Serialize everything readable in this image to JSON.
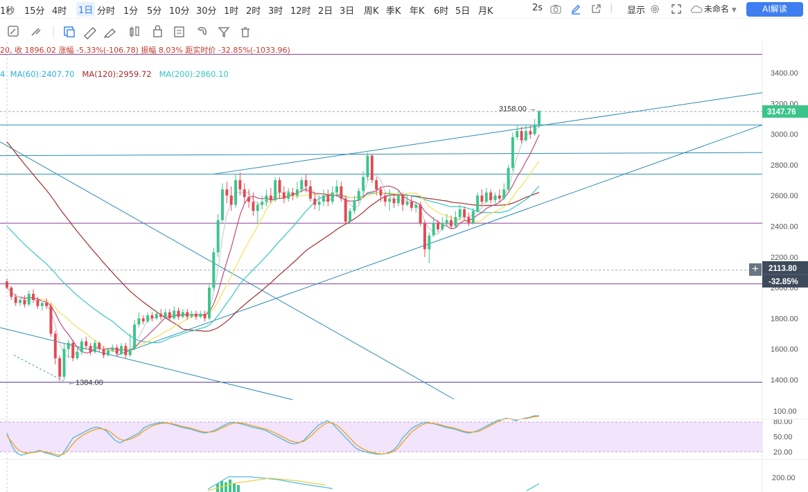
{
  "periods": [
    "1秒",
    "15分",
    "4时",
    "1日",
    "分时",
    "1分",
    "5分",
    "10分",
    "30分",
    "1时",
    "2时",
    "3时",
    "12时",
    "2日",
    "3日",
    "周K",
    "季K",
    "年K",
    "6时",
    "5日",
    "月K"
  ],
  "active_period": "1日",
  "top_right": {
    "refresh": "2s",
    "display": "显示",
    "layout_name": "未命名",
    "ai_button": "AI解读"
  },
  "info_line": {
    "prefix": "20,",
    "close": "收 1896.02",
    "change": "涨幅 -5.33%(-106.78)",
    "amplitude": "振幅 8.03%",
    "distance": "距实时价 -32.85%(-1033.96)"
  },
  "ma_legend": [
    {
      "label": "MA(60):2407.70",
      "color": "#2ab0d6"
    },
    {
      "label": "MA(120):2959.72",
      "color": "#a12c2c"
    },
    {
      "label": "MA(200):2860.10",
      "color": "#35c6c2"
    }
  ],
  "colors": {
    "up": "#3cc58b",
    "down": "#e04a54",
    "price_tag": "#3cc58b",
    "cursor_tag": "#3d4a5c"
  },
  "chart_data": {
    "type": "candlestick",
    "y_ticks": [
      3400,
      3200,
      3000,
      2800,
      2600,
      2400,
      2200,
      2000,
      1800,
      1600,
      1400
    ],
    "y_tick_labels": [
      "3400.00",
      "3200.00",
      "3000.00",
      "2800.00",
      "2600.00",
      "2400.00",
      "2200.00",
      "2000.00",
      "1800.00",
      "1600.00",
      "1400.00"
    ],
    "last_price": 3147.76,
    "last_price_label": "3147.76",
    "cursor_price_label": "2113.80",
    "cursor_pct_label": "-32.85%",
    "high_label": "3158.00",
    "low_label": "1384.00",
    "candles": [
      [
        2040,
        2000,
        2060,
        1990
      ],
      [
        2000,
        1940,
        2010,
        1920
      ],
      [
        1940,
        1900,
        1960,
        1880
      ],
      [
        1900,
        1920,
        1940,
        1880
      ],
      [
        1920,
        1890,
        1950,
        1870
      ],
      [
        1890,
        1960,
        1980,
        1880
      ],
      [
        1960,
        1920,
        1990,
        1900
      ],
      [
        1920,
        1880,
        1940,
        1860
      ],
      [
        1880,
        1900,
        1910,
        1850
      ],
      [
        1900,
        1880,
        1930,
        1860
      ],
      [
        1880,
        1700,
        1900,
        1680
      ],
      [
        1700,
        1540,
        1720,
        1500
      ],
      [
        1540,
        1420,
        1560,
        1390
      ],
      [
        1420,
        1600,
        1640,
        1400
      ],
      [
        1600,
        1640,
        1660,
        1540
      ],
      [
        1640,
        1540,
        1660,
        1520
      ],
      [
        1540,
        1580,
        1620,
        1530
      ],
      [
        1580,
        1650,
        1670,
        1560
      ],
      [
        1650,
        1620,
        1680,
        1600
      ],
      [
        1620,
        1580,
        1640,
        1560
      ],
      [
        1580,
        1640,
        1660,
        1570
      ],
      [
        1640,
        1600,
        1650,
        1580
      ],
      [
        1600,
        1560,
        1620,
        1540
      ],
      [
        1560,
        1590,
        1610,
        1550
      ],
      [
        1590,
        1610,
        1630,
        1580
      ],
      [
        1610,
        1570,
        1630,
        1550
      ],
      [
        1570,
        1620,
        1640,
        1560
      ],
      [
        1620,
        1560,
        1640,
        1540
      ],
      [
        1560,
        1600,
        1700,
        1550
      ],
      [
        1600,
        1760,
        1790,
        1590
      ],
      [
        1760,
        1800,
        1840,
        1740
      ],
      [
        1800,
        1780,
        1820,
        1760
      ],
      [
        1780,
        1820,
        1840,
        1770
      ],
      [
        1820,
        1800,
        1840,
        1780
      ],
      [
        1800,
        1830,
        1850,
        1790
      ],
      [
        1830,
        1810,
        1860,
        1790
      ],
      [
        1810,
        1840,
        1860,
        1800
      ],
      [
        1840,
        1800,
        1860,
        1780
      ],
      [
        1800,
        1850,
        1880,
        1790
      ],
      [
        1850,
        1810,
        1870,
        1790
      ],
      [
        1810,
        1840,
        1860,
        1800
      ],
      [
        1840,
        1810,
        1860,
        1790
      ],
      [
        1810,
        1830,
        1850,
        1800
      ],
      [
        1830,
        1810,
        1850,
        1790
      ],
      [
        1810,
        1830,
        1850,
        1800
      ],
      [
        1830,
        1800,
        1850,
        1780
      ],
      [
        1800,
        2000,
        2020,
        1790
      ],
      [
        2000,
        2230,
        2260,
        1980
      ],
      [
        2230,
        2440,
        2480,
        2200
      ],
      [
        2440,
        2640,
        2680,
        2420
      ],
      [
        2640,
        2600,
        2690,
        2550
      ],
      [
        2600,
        2540,
        2660,
        2500
      ],
      [
        2540,
        2700,
        2740,
        2520
      ],
      [
        2700,
        2640,
        2750,
        2600
      ],
      [
        2640,
        2590,
        2680,
        2550
      ],
      [
        2590,
        2560,
        2640,
        2520
      ],
      [
        2560,
        2500,
        2620,
        2470
      ],
      [
        2500,
        2540,
        2560,
        2420
      ],
      [
        2540,
        2560,
        2600,
        2510
      ],
      [
        2560,
        2600,
        2640,
        2530
      ],
      [
        2600,
        2570,
        2650,
        2550
      ],
      [
        2570,
        2700,
        2720,
        2560
      ],
      [
        2700,
        2620,
        2720,
        2580
      ],
      [
        2620,
        2580,
        2660,
        2550
      ],
      [
        2580,
        2620,
        2650,
        2560
      ],
      [
        2620,
        2600,
        2650,
        2570
      ],
      [
        2600,
        2640,
        2690,
        2580
      ],
      [
        2640,
        2700,
        2720,
        2620
      ],
      [
        2700,
        2660,
        2740,
        2620
      ],
      [
        2660,
        2580,
        2700,
        2560
      ],
      [
        2580,
        2540,
        2620,
        2510
      ],
      [
        2540,
        2560,
        2600,
        2500
      ],
      [
        2560,
        2600,
        2640,
        2530
      ],
      [
        2600,
        2560,
        2640,
        2530
      ],
      [
        2560,
        2620,
        2660,
        2540
      ],
      [
        2620,
        2660,
        2700,
        2600
      ],
      [
        2660,
        2580,
        2690,
        2560
      ],
      [
        2580,
        2430,
        2600,
        2410
      ],
      [
        2430,
        2500,
        2520,
        2420
      ],
      [
        2500,
        2570,
        2600,
        2480
      ],
      [
        2570,
        2630,
        2650,
        2550
      ],
      [
        2630,
        2720,
        2760,
        2600
      ],
      [
        2720,
        2860,
        2880,
        2700
      ],
      [
        2860,
        2700,
        2870,
        2680
      ],
      [
        2700,
        2640,
        2720,
        2600
      ],
      [
        2640,
        2600,
        2660,
        2560
      ],
      [
        2600,
        2560,
        2620,
        2530
      ],
      [
        2560,
        2580,
        2640,
        2500
      ],
      [
        2580,
        2550,
        2610,
        2520
      ],
      [
        2550,
        2600,
        2640,
        2530
      ],
      [
        2600,
        2540,
        2620,
        2500
      ],
      [
        2540,
        2560,
        2600,
        2530
      ],
      [
        2560,
        2520,
        2600,
        2500
      ],
      [
        2520,
        2540,
        2560,
        2490
      ],
      [
        2540,
        2420,
        2560,
        2400
      ],
      [
        2420,
        2250,
        2440,
        2200
      ],
      [
        2250,
        2340,
        2360,
        2160
      ],
      [
        2340,
        2420,
        2460,
        2330
      ],
      [
        2420,
        2380,
        2440,
        2360
      ],
      [
        2380,
        2420,
        2460,
        2370
      ],
      [
        2420,
        2440,
        2480,
        2400
      ],
      [
        2440,
        2400,
        2470,
        2380
      ],
      [
        2400,
        2460,
        2500,
        2390
      ],
      [
        2460,
        2510,
        2540,
        2440
      ],
      [
        2510,
        2460,
        2530,
        2440
      ],
      [
        2460,
        2420,
        2490,
        2400
      ],
      [
        2420,
        2500,
        2520,
        2410
      ],
      [
        2500,
        2600,
        2620,
        2490
      ],
      [
        2600,
        2560,
        2640,
        2540
      ],
      [
        2560,
        2620,
        2650,
        2550
      ],
      [
        2620,
        2570,
        2640,
        2550
      ],
      [
        2570,
        2600,
        2620,
        2550
      ],
      [
        2600,
        2580,
        2640,
        2560
      ],
      [
        2580,
        2640,
        2680,
        2570
      ],
      [
        2640,
        2780,
        2800,
        2630
      ],
      [
        2780,
        2980,
        3010,
        2760
      ],
      [
        2980,
        3020,
        3060,
        2960
      ],
      [
        3020,
        2960,
        3050,
        2940
      ],
      [
        2960,
        3020,
        3060,
        2950
      ],
      [
        3020,
        3000,
        3060,
        2970
      ],
      [
        3000,
        3060,
        3100,
        2990
      ],
      [
        3060,
        3150,
        3158,
        3040
      ]
    ],
    "ma_short": [
      1980,
      1960,
      1930,
      1915,
      1900,
      1900,
      1895,
      1885,
      1875,
      1870,
      1830,
      1760,
      1680,
      1650,
      1630,
      1610,
      1600,
      1600,
      1600,
      1600,
      1600,
      1600,
      1595,
      1590,
      1590,
      1590,
      1590,
      1585,
      1590,
      1620,
      1660,
      1700,
      1730,
      1750,
      1770,
      1780,
      1790,
      1800,
      1805,
      1810,
      1815,
      1815,
      1820,
      1820,
      1820,
      1820,
      1860,
      1940,
      2050,
      2180,
      2290,
      2390,
      2470,
      2530,
      2570,
      2580,
      2580,
      2570,
      2570,
      2570,
      2580,
      2600,
      2610,
      2610,
      2610,
      2610,
      2620,
      2630,
      2640,
      2640,
      2620,
      2600,
      2590,
      2580,
      2590,
      2600,
      2600,
      2570,
      2540,
      2530,
      2540,
      2560,
      2620,
      2660,
      2680,
      2660,
      2630,
      2600,
      2580,
      2570,
      2570,
      2560,
      2550,
      2540,
      2510,
      2450,
      2420,
      2400,
      2400,
      2400,
      2410,
      2420,
      2430,
      2450,
      2460,
      2460,
      2460,
      2470,
      2500,
      2530,
      2550,
      2560,
      2570,
      2580,
      2590,
      2650,
      2740,
      2820,
      2880,
      2920,
      2960,
      2990,
      3020
    ],
    "osc_k": [
      60,
      35,
      20,
      15,
      18,
      20,
      22,
      25,
      20,
      18,
      15,
      12,
      20,
      35,
      50,
      55,
      60,
      65,
      70,
      72,
      70,
      65,
      55,
      45,
      40,
      45,
      50,
      55,
      60,
      70,
      75,
      78,
      80,
      82,
      80,
      78,
      75,
      72,
      70,
      68,
      65,
      62,
      60,
      62,
      65,
      70,
      75,
      80,
      82,
      80,
      78,
      75,
      72,
      70,
      68,
      65,
      60,
      55,
      50,
      45,
      40,
      38,
      40,
      45,
      55,
      65,
      75,
      80,
      85,
      80,
      70,
      60,
      50,
      40,
      30,
      25,
      22,
      20,
      18,
      17,
      18,
      20,
      25,
      35,
      50,
      60,
      70,
      75,
      80,
      82,
      80,
      78,
      75,
      72,
      70,
      68,
      65,
      62,
      60,
      62,
      65,
      70,
      75,
      80,
      85,
      88,
      90,
      88,
      85,
      88,
      90,
      92,
      95,
      95
    ],
    "osc_d": [
      55,
      42,
      30,
      22,
      20,
      20,
      21,
      23,
      22,
      20,
      18,
      15,
      17,
      26,
      38,
      48,
      55,
      60,
      65,
      68,
      69,
      67,
      62,
      54,
      47,
      45,
      47,
      51,
      56,
      64,
      70,
      75,
      78,
      80,
      80,
      79,
      77,
      74,
      72,
      70,
      67,
      64,
      62,
      62,
      63,
      67,
      72,
      76,
      80,
      81,
      80,
      78,
      75,
      73,
      70,
      68,
      64,
      60,
      55,
      50,
      45,
      42,
      41,
      43,
      50,
      58,
      68,
      75,
      81,
      81,
      76,
      68,
      58,
      48,
      38,
      31,
      26,
      22,
      20,
      18,
      18,
      19,
      22,
      29,
      41,
      52,
      63,
      70,
      76,
      80,
      80,
      79,
      77,
      74,
      72,
      70,
      67,
      64,
      62,
      62,
      63,
      67,
      72,
      77,
      82,
      86,
      89,
      89,
      87,
      88,
      89,
      91,
      93,
      94
    ],
    "osc_ticks": [
      "100.00",
      "80.00",
      "50.00",
      "20.00"
    ],
    "vol_tick": "200.00"
  }
}
